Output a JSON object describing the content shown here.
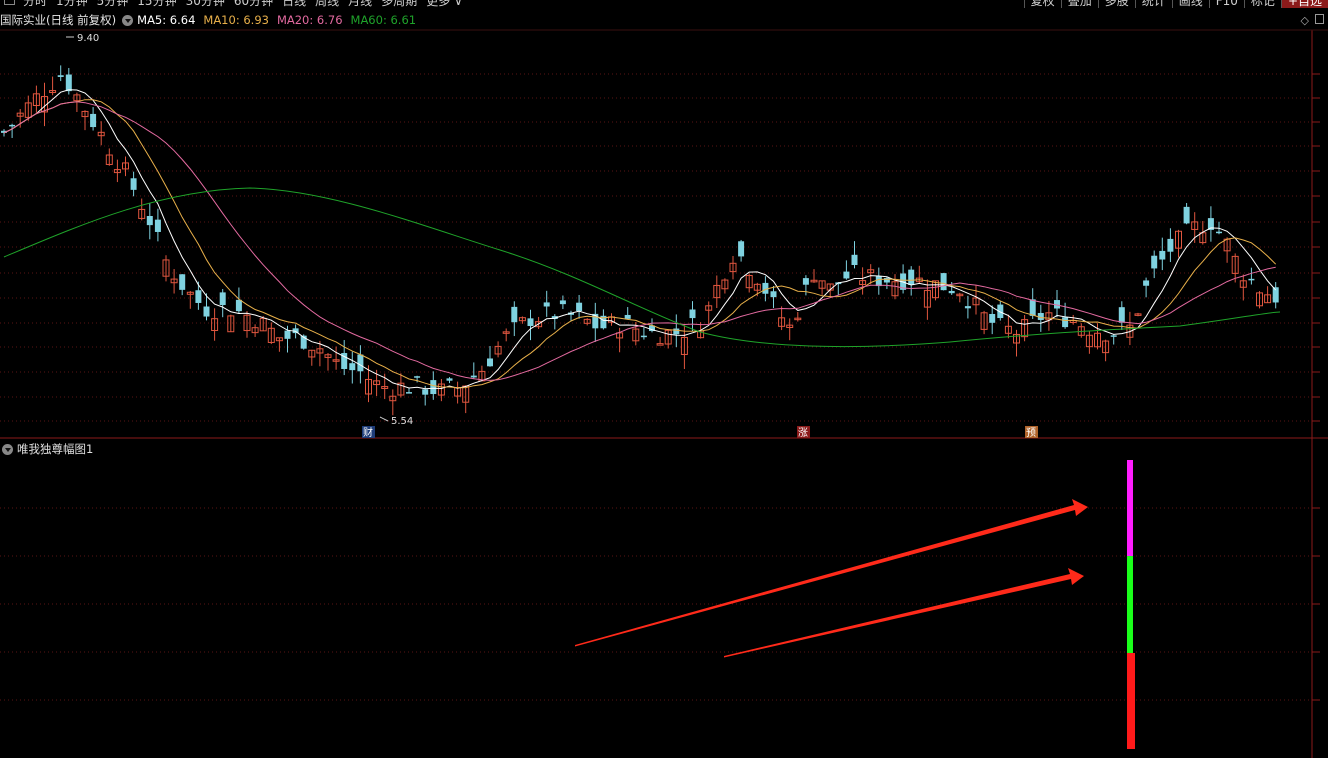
{
  "top_tabs": [
    "分时",
    "1分钟",
    "5分钟",
    "15分钟",
    "30分钟",
    "60分钟",
    "日线",
    "周线",
    "月线",
    "多周期",
    "更多 ∨"
  ],
  "right_buttons": [
    "复权",
    "叠加",
    "多股",
    "统计",
    "画线",
    "F10",
    "标记",
    "+自选"
  ],
  "stock": {
    "name": "国际实业(日线 前复权)"
  },
  "ma": [
    {
      "label": "MA5: 6.64",
      "color": "#ffffff"
    },
    {
      "label": "MA10: 6.93",
      "color": "#e8b04a"
    },
    {
      "label": "MA20: 6.76",
      "color": "#e36aa0"
    },
    {
      "label": "MA60: 6.61",
      "color": "#1fa32a"
    }
  ],
  "price_high": "9.40",
  "price_low": "5.54",
  "markers": [
    {
      "text": "财",
      "bg": "#1e3c78"
    },
    {
      "text": "涨",
      "bg": "#8b1a1a"
    },
    {
      "text": "预",
      "bg": "#b0632a"
    }
  ],
  "sub_indicator": {
    "title": "唯我独尊幅图1"
  },
  "colors": {
    "up": "#e0563f",
    "down": "#7fd2e0",
    "arrow": "#ff2a1a",
    "bar_top": "#ff1dff",
    "bar_mid": "#1aff1a",
    "bar_bot": "#ff1a1a",
    "grid": "#8b1a1a"
  }
}
